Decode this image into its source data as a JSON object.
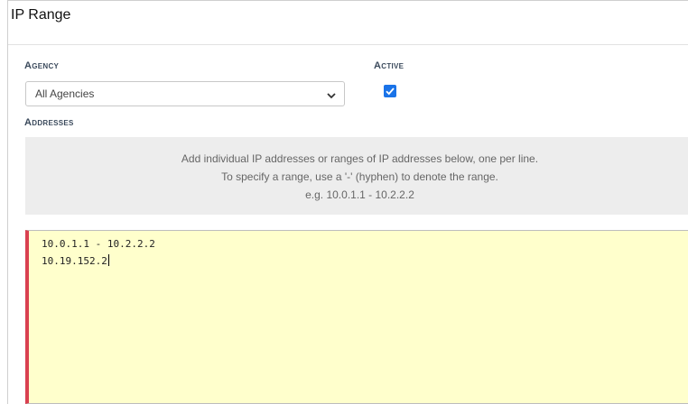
{
  "panel": {
    "title": "IP Range"
  },
  "agency": {
    "label": "Agency",
    "selected": "All Agencies",
    "icon": "chevron-down-icon"
  },
  "active": {
    "label": "Active",
    "checked": true,
    "color": "#1a73e8"
  },
  "addresses": {
    "label": "Addresses",
    "help": [
      "Add individual IP addresses or ranges of IP addresses below, one per line.",
      "To specify a range, use a '-' (hyphen) to denote the range.",
      "e.g. 10.0.1.1 - 10.2.2.2"
    ],
    "lines": [
      "10.0.1.1 - 10.2.2.2",
      "10.19.152.2"
    ],
    "field_background": "#ffffcc",
    "error_color": "#d94050"
  }
}
